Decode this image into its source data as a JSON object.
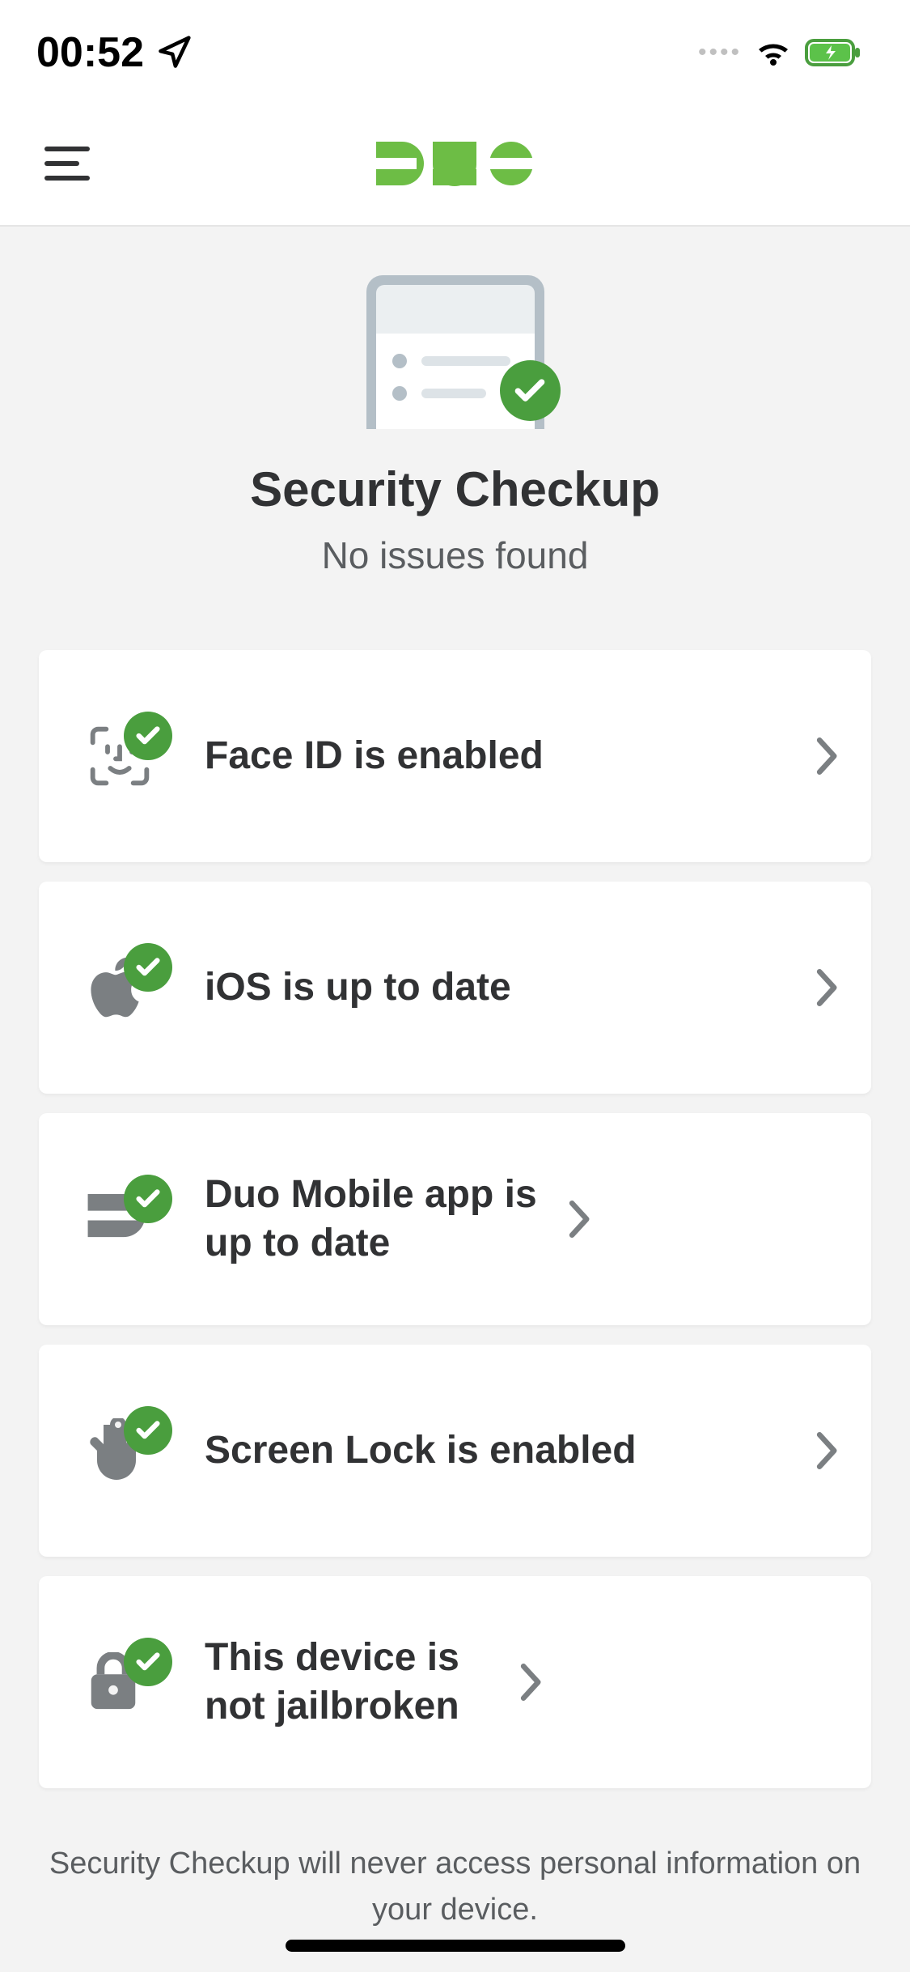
{
  "status_bar": {
    "time": "00:52"
  },
  "header": {
    "logo_text": "DUO"
  },
  "hero": {
    "title": "Security Checkup",
    "subtitle": "No issues found"
  },
  "items": [
    {
      "label": "Face ID is enabled",
      "icon": "faceid-icon"
    },
    {
      "label": "iOS is up to date",
      "icon": "apple-icon"
    },
    {
      "label": "Duo Mobile app is up to date",
      "icon": "duo-app-icon"
    },
    {
      "label": "Screen Lock is enabled",
      "icon": "touch-icon"
    },
    {
      "label": "This device is not jailbroken",
      "icon": "lock-icon"
    }
  ],
  "footer": {
    "text": "Security Checkup will never access personal information on your device."
  },
  "colors": {
    "accent": "#6dbd45",
    "check_green": "#4a9e3e",
    "icon_gray": "#7b7f82"
  }
}
